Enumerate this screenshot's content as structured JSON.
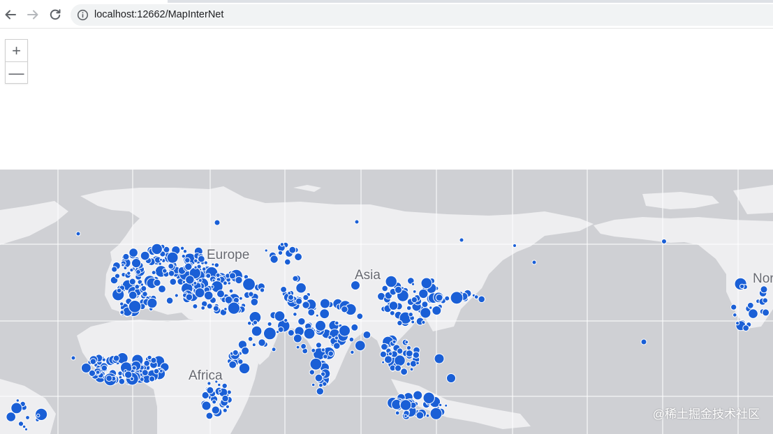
{
  "browser": {
    "url": "localhost:12662/MapInterNet",
    "back_icon": "arrow-left-icon",
    "forward_icon": "arrow-right-icon",
    "reload_icon": "reload-icon",
    "info_icon": "info-icon"
  },
  "map": {
    "zoom_in_label": "+",
    "zoom_out_label": "—",
    "labels": {
      "europe": "Europe",
      "asia": "Asia",
      "africa": "Africa",
      "north": "Nor"
    },
    "watermark": "@稀土掘金技术社区",
    "colors": {
      "water": "#cfd0d4",
      "land": "#eeeef0",
      "graticule": "#ffffff",
      "marker_fill": "#1a5fd6",
      "marker_stroke": "#ffffff"
    }
  }
}
